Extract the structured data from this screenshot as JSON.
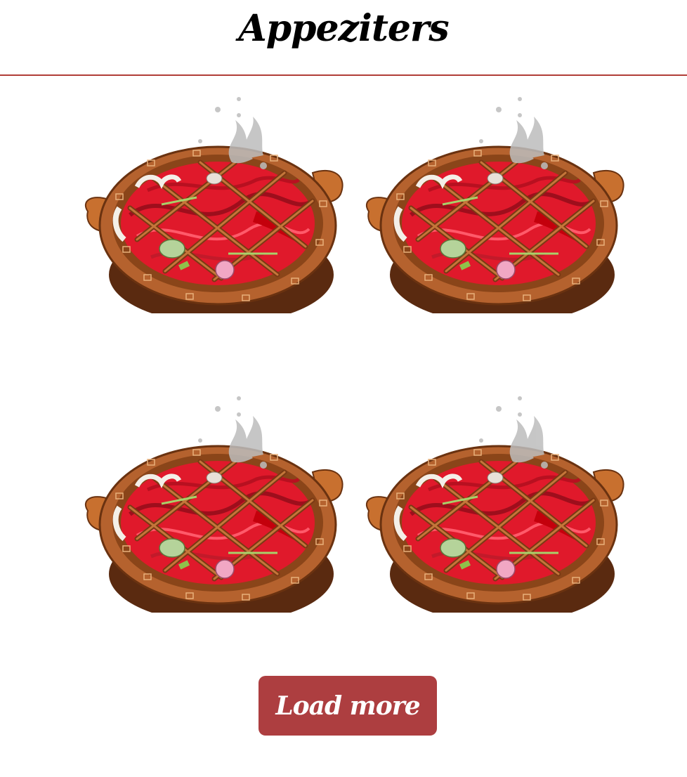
{
  "header": {
    "title": "Appeziters"
  },
  "menu": {
    "items": [
      {
        "image": "hotpot-pot-image"
      },
      {
        "image": "hotpot-pot-image"
      },
      {
        "image": "hotpot-pot-image"
      },
      {
        "image": "hotpot-pot-image"
      }
    ]
  },
  "actions": {
    "load_more_label": "Load more"
  },
  "colors": {
    "accent": "#ad3e40",
    "divider": "#b13d37",
    "pot_rim": "#b5622e",
    "broth": "#e0192b"
  }
}
